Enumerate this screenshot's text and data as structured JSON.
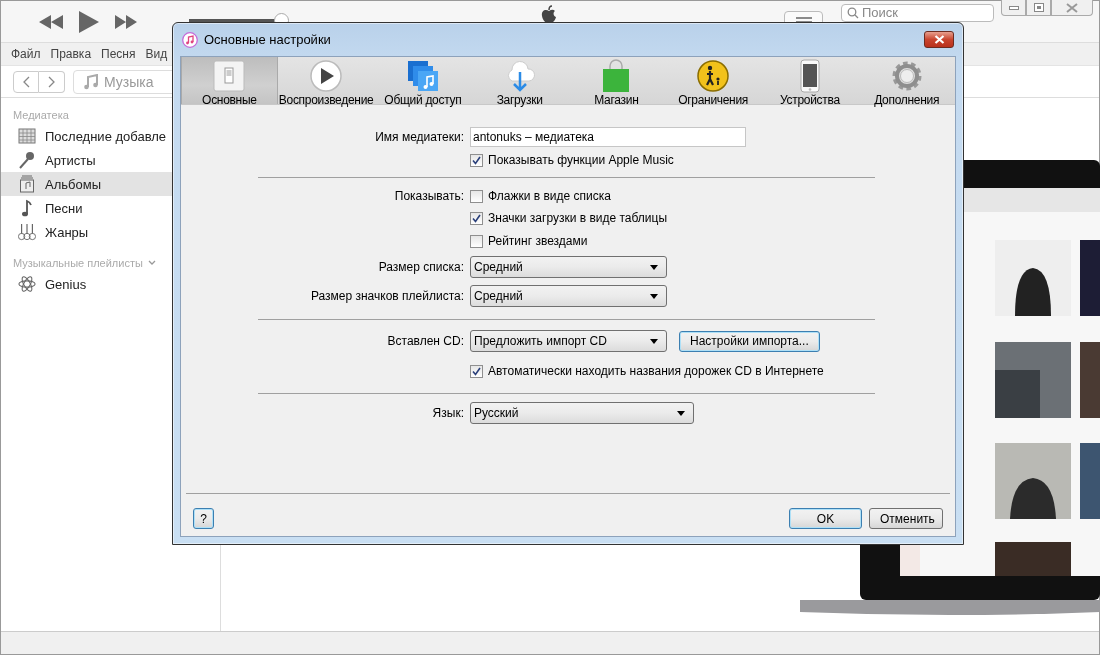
{
  "window": {
    "transport": {
      "volume": {
        "level": 0.93
      }
    },
    "search": {
      "placeholder": "Поиск"
    },
    "menu": [
      "Файл",
      "Правка",
      "Песня",
      "Вид"
    ],
    "source": "Музыка",
    "sidebar": {
      "sections": [
        {
          "title": "Медиатека",
          "items": [
            {
              "label": "Последние добавле",
              "selected": false
            },
            {
              "label": "Артисты",
              "selected": false
            },
            {
              "label": "Альбомы",
              "selected": true
            },
            {
              "label": "Песни",
              "selected": false
            },
            {
              "label": "Жанры",
              "selected": false
            }
          ]
        },
        {
          "title": "Музыкальные плейлисты",
          "expanded": true,
          "items": [
            {
              "label": "Genius",
              "selected": false
            }
          ]
        }
      ]
    }
  },
  "dialog": {
    "title": "Основные настройки",
    "tabs": [
      {
        "label": "Основные",
        "selected": true
      },
      {
        "label": "Воспроизведение",
        "selected": false
      },
      {
        "label": "Общий доступ",
        "selected": false
      },
      {
        "label": "Загрузки",
        "selected": false
      },
      {
        "label": "Магазин",
        "selected": false
      },
      {
        "label": "Ограничения",
        "selected": false
      },
      {
        "label": "Устройства",
        "selected": false
      },
      {
        "label": "Дополнения",
        "selected": false
      }
    ],
    "library_name": {
      "label": "Имя медиатеки:",
      "value": "antonuks – медиатека"
    },
    "show_apple_music": {
      "label": "Показывать функции Apple Music",
      "checked": true
    },
    "show": {
      "label": "Показывать:",
      "options": [
        {
          "label": "Флажки в виде списка",
          "checked": false
        },
        {
          "label": "Значки загрузки в виде таблицы",
          "checked": true
        },
        {
          "label": "Рейтинг звездами",
          "checked": false
        }
      ]
    },
    "list_size": {
      "label": "Размер списка:",
      "value": "Средний"
    },
    "playlist_icon_size": {
      "label": "Размер значков плейлиста:",
      "value": "Средний"
    },
    "cd_inserted": {
      "label": "Вставлен CD:",
      "value": "Предложить импорт CD"
    },
    "import_settings_button": "Настройки импорта...",
    "auto_names": {
      "label": "Автоматически находить названия дорожек CD в Интернете",
      "checked": true
    },
    "language": {
      "label": "Язык:",
      "value": "Русский"
    },
    "buttons": {
      "help": "?",
      "ok": "OK",
      "cancel": "Отменить"
    }
  }
}
